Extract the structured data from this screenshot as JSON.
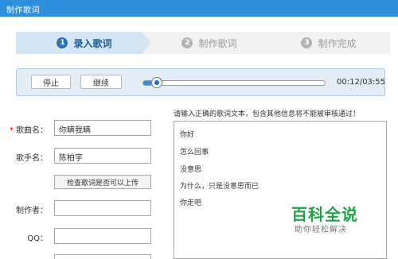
{
  "window": {
    "title": "制作歌词"
  },
  "steps": [
    {
      "num": "1",
      "label": "录入歌词",
      "active": true
    },
    {
      "num": "2",
      "label": "制作歌词",
      "active": false
    },
    {
      "num": "3",
      "label": "制作完成",
      "active": false
    }
  ],
  "player": {
    "stop_label": "停止",
    "continue_label": "继续",
    "time": "00:12/03:55",
    "progress": 0.05
  },
  "form": {
    "song_name_label": "歌曲名：",
    "song_name_value": "你瞒我瞒",
    "singer_label": "歌手名：",
    "singer_value": "陈柏宇",
    "check_button": "检查歌词是否可以上传",
    "maker_label": "制作者：",
    "maker_value": "",
    "qq_label": "QQ：",
    "qq_value": ""
  },
  "lyrics": {
    "hint": "请输入正确的歌词文本，包含其他信息将不能被审核通过！",
    "lines": [
      "你好",
      "怎么回事",
      "没意思",
      "为什么，只是没意思而已",
      "你走吧"
    ]
  },
  "watermark": {
    "main": "百科全说",
    "sub": "助你轻松解决"
  },
  "colors": {
    "accent": "#2e8fdc",
    "brand_green": "#22a24a"
  }
}
